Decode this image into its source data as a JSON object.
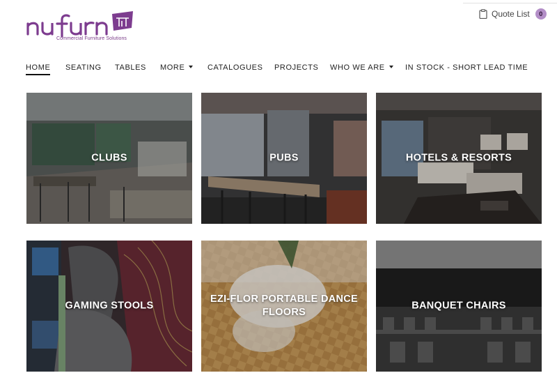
{
  "brand": {
    "name": "nufurn",
    "tagline": "Commercial Furniture Solutions",
    "accent": "#7d3c8f",
    "accent_light": "#b38ec7"
  },
  "quote": {
    "label": "Quote List",
    "count": "0",
    "icon": "clipboard-icon"
  },
  "nav": {
    "items": [
      {
        "label": "HOME",
        "active": true
      },
      {
        "label": "SEATING"
      },
      {
        "label": "TABLES"
      },
      {
        "label": "MORE",
        "dropdown": true
      },
      {
        "label": "CATALOGUES"
      },
      {
        "label": "PROJECTS"
      },
      {
        "label": "WHO WE ARE",
        "dropdown": true
      },
      {
        "label": "IN STOCK - SHORT LEAD TIME"
      }
    ]
  },
  "tiles": [
    {
      "label": "CLUBS"
    },
    {
      "label": "PUBS"
    },
    {
      "label": "HOTELS & RESORTS"
    },
    {
      "label": "GAMING STOOLS"
    },
    {
      "label": "EZI-FLOR PORTABLE DANCE FLOORS"
    },
    {
      "label": "BANQUET CHAIRS"
    }
  ]
}
